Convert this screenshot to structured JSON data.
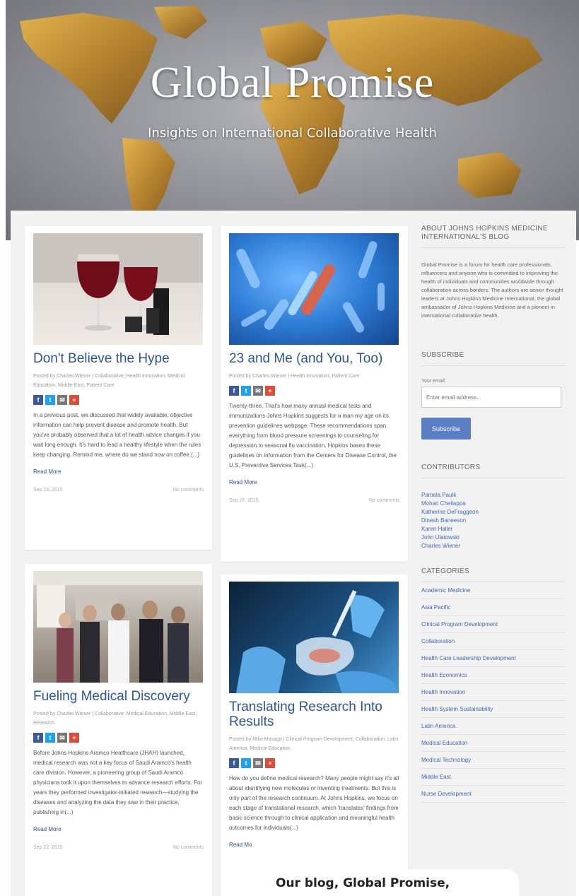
{
  "hero": {
    "title": "Global Promise",
    "subtitle": "Insights on International Collaborative Health"
  },
  "posts": [
    {
      "title": "Don't Believe the Hype",
      "meta": "Posted by Charles Wiener | Collaborative, Health Innovation, Medical Education, Middle East, Patient Care",
      "excerpt": "In a previous post, we discussed that widely available, objective information can help prevent disease and promote health. But you've probably observed that a lot of health advice changes if you wait long enough. It's hard to lead a healthy lifestyle when the rules keep changing. Remind me, where do we stand now on coffee.(...)",
      "read_more": "Read More",
      "date": "Sep 23, 2015",
      "comments": "No comments"
    },
    {
      "title": "23 and Me (and You, Too)",
      "meta": "Posted by Charles Wiener | Health Innovation, Patient Care",
      "excerpt": "Twenty-three. That's how many annual medical tests and immunizations Johns Hopkins suggests for a man my age on its prevention guidelines webpage. These recommendations span everything from blood pressure screenings to counseling for depression to seasonal flu vaccination. Hopkins bases these guidelines on information from the Centers for Disease Control, the U.S. Preventive Services Task(...)",
      "read_more": "Read More",
      "date": "Sep 27, 2015",
      "comments": "No comments"
    },
    {
      "title": "Fueling Medical Discovery",
      "meta": "Posted by Charles Wiener | Collaborative, Medical Education, Middle East, Research",
      "excerpt": "Before Johns Hopkins Aramco Healthcare (JHAH) launched, medical research was not a key focus of Saudi Aramco's health care division. However, a pioneering group of Saudi Aramco physicians took it upon themselves to advance research efforts. For years they performed investigator-initiated research—studying the diseases and analyzing the data they saw in their practice, publishing in(...)",
      "read_more": "Read More",
      "date": "Sep 22, 2015",
      "comments": "No comments"
    },
    {
      "title": "Translating Research Into Results",
      "meta": "Posted by Mike Mosaga | Clinical Program Development, Collaboration, Latin America, Medical Education",
      "excerpt": "How do you define medical research? Many people might say it's all about identifying new molecules or inventing treatments. But this is only part of the research continuum. At Johns Hopkins, we focus on each stage of translational research, which 'translates' findings from basic science through to clinical application and meaningful health outcomes for individuals(...)",
      "read_more": "Read Mo",
      "date": "",
      "comments": ""
    }
  ],
  "sidebar": {
    "about_title": "About Johns Hopkins Medicine International's Blog",
    "about_text": "Global Promise is a forum for health care professionals, influencers and anyone who is committed to improving the health of individuals and communities worldwide through collaboration across borders. The authors are senior thought leaders at Johns Hopkins Medicine International, the global ambassador of Johns Hopkins Medicine and a pioneer in international collaborative health.",
    "subscribe_title": "Subscribe",
    "email_label": "Your email:",
    "email_placeholder": "Enter email address...",
    "subscribe_button": "Subscribe",
    "contributors_title": "Contributors",
    "contributors": [
      "Pamela Paulk",
      "Mohan Chellappa",
      "Katherine DeFraggeon",
      "Dinesh Baneeson",
      "Karen Haller",
      "John Ulatowski",
      "Charles Wiener"
    ],
    "categories_title": "Categories",
    "categories": [
      "Academic Medicine",
      "Asia Pacific",
      "Clinical Program Development",
      "Collaboration",
      "Health Care Leadership Development",
      "Health Economics",
      "Health Innovation",
      "Health System Sustainability",
      "Latin America",
      "Medical Education",
      "Medical Technology",
      "Middle East",
      "Nurse Development"
    ]
  },
  "overlay_caption": "Our blog, Global Promise,"
}
